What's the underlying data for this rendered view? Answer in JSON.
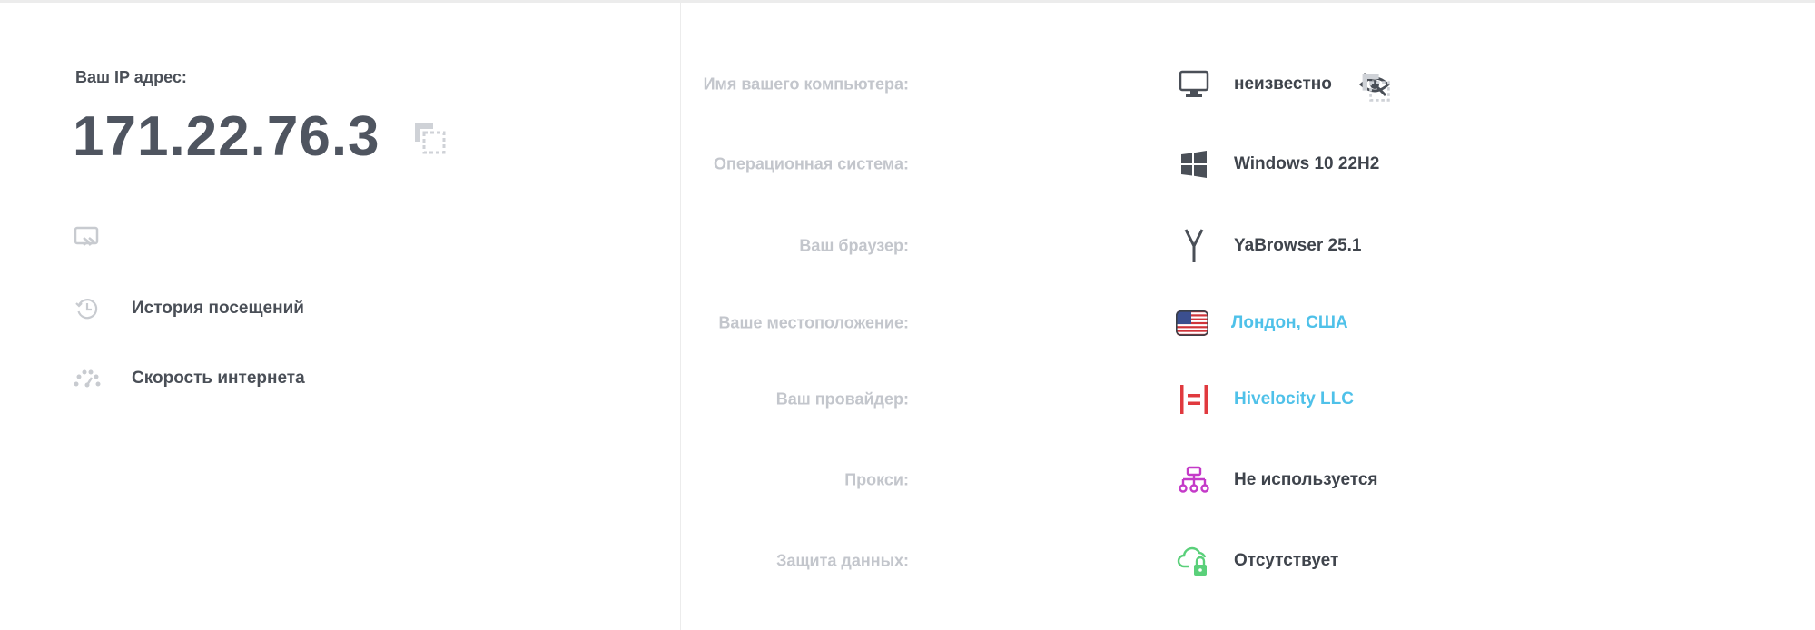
{
  "left": {
    "ip_label": "Ваш IP адрес:",
    "ip_value": "171.22.76.3",
    "menu": [
      {
        "label": "История посещений",
        "icon": "history-icon"
      },
      {
        "label": "Скорость интернета",
        "icon": "speedometer-icon"
      }
    ]
  },
  "info": [
    {
      "label": "Имя вашего компьютера:",
      "value": "неизвестно",
      "icon": "monitor-icon"
    },
    {
      "label": "Операционная система:",
      "value": "Windows 10 22H2",
      "icon": "windows-icon"
    },
    {
      "label": "Ваш браузер:",
      "value": "YaBrowser 25.1",
      "icon": "yandex-browser-icon"
    },
    {
      "label": "Ваше местоположение:",
      "value": "Лондон, США",
      "icon": "us-flag-icon"
    },
    {
      "label": "Ваш провайдер:",
      "value": "Hivelocity LLC",
      "icon": "hivelocity-logo-icon"
    },
    {
      "label": "Прокси:",
      "value": "Не используется",
      "icon": "proxy-network-icon"
    },
    {
      "label": "Защита данных:",
      "value": "Отсутствует",
      "icon": "cloud-lock-icon"
    }
  ],
  "colors": {
    "text_dark": "#4a4f57",
    "label_gray": "#c3c6cc",
    "link_blue": "#4fc1e9",
    "provider_red": "#e0393e",
    "proxy_magenta": "#c43ac8",
    "protection_green": "#5ad07a"
  }
}
